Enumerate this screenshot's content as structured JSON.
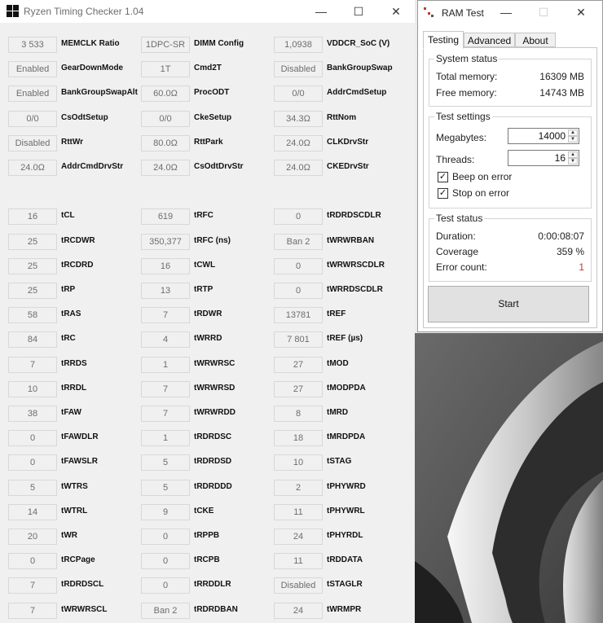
{
  "rtc": {
    "title": "Ryzen Timing Checker 1.04",
    "minimize_glyph": "—",
    "maximize_glyph": "☐",
    "close_glyph": "✕",
    "columns": [
      [
        {
          "value": "3 533",
          "label": "MEMCLK Ratio"
        },
        {
          "value": "Enabled",
          "label": "GearDownMode"
        },
        {
          "value": "Enabled",
          "label": "BankGroupSwapAlt"
        },
        {
          "value": "0/0",
          "label": "CsOdtSetup"
        },
        {
          "value": "Disabled",
          "label": "RttWr"
        },
        {
          "value": "24.0Ω",
          "label": "AddrCmdDrvStr"
        },
        null,
        {
          "value": "16",
          "label": "tCL"
        },
        {
          "value": "25",
          "label": "tRCDWR"
        },
        {
          "value": "25",
          "label": "tRCDRD"
        },
        {
          "value": "25",
          "label": "tRP"
        },
        {
          "value": "58",
          "label": "tRAS"
        },
        {
          "value": "84",
          "label": "tRC"
        },
        {
          "value": "7",
          "label": "tRRDS"
        },
        {
          "value": "10",
          "label": "tRRDL"
        },
        {
          "value": "38",
          "label": "tFAW"
        },
        {
          "value": "0",
          "label": "tFAWDLR"
        },
        {
          "value": "0",
          "label": "tFAWSLR"
        },
        {
          "value": "5",
          "label": "tWTRS"
        },
        {
          "value": "14",
          "label": "tWTRL"
        },
        {
          "value": "20",
          "label": "tWR"
        },
        {
          "value": "0",
          "label": "tRCPage"
        },
        {
          "value": "7",
          "label": "tRDRDSCL"
        },
        {
          "value": "7",
          "label": "tWRWRSCL"
        }
      ],
      [
        {
          "value": "1DPC-SR",
          "label": "DIMM Config"
        },
        {
          "value": "1T",
          "label": "Cmd2T"
        },
        {
          "value": "60.0Ω",
          "label": "ProcODT"
        },
        {
          "value": "0/0",
          "label": "CkeSetup"
        },
        {
          "value": "80.0Ω",
          "label": "RttPark"
        },
        {
          "value": "24.0Ω",
          "label": "CsOdtDrvStr"
        },
        null,
        {
          "value": "619",
          "label": "tRFC"
        },
        {
          "value": "350,377",
          "label": "tRFC (ns)"
        },
        {
          "value": "16",
          "label": "tCWL"
        },
        {
          "value": "13",
          "label": "tRTP"
        },
        {
          "value": "7",
          "label": "tRDWR"
        },
        {
          "value": "4",
          "label": "tWRRD"
        },
        {
          "value": "1",
          "label": "tWRWRSC"
        },
        {
          "value": "7",
          "label": "tWRWRSD"
        },
        {
          "value": "7",
          "label": "tWRWRDD"
        },
        {
          "value": "1",
          "label": "tRDRDSC"
        },
        {
          "value": "5",
          "label": "tRDRDSD"
        },
        {
          "value": "5",
          "label": "tRDRDDD"
        },
        {
          "value": "9",
          "label": "tCKE"
        },
        {
          "value": "0",
          "label": "tRPPB"
        },
        {
          "value": "0",
          "label": "tRCPB"
        },
        {
          "value": "0",
          "label": "tRRDDLR"
        },
        {
          "value": "Ban 2",
          "label": "tRDRDBAN"
        }
      ],
      [
        {
          "value": "1,0938",
          "label": "VDDCR_SoC (V)"
        },
        {
          "value": "Disabled",
          "label": "BankGroupSwap"
        },
        {
          "value": "0/0",
          "label": "AddrCmdSetup"
        },
        {
          "value": "34.3Ω",
          "label": "RttNom"
        },
        {
          "value": "24.0Ω",
          "label": "CLKDrvStr"
        },
        {
          "value": "24.0Ω",
          "label": "CKEDrvStr"
        },
        null,
        {
          "value": "0",
          "label": "tRDRDSCDLR"
        },
        {
          "value": "Ban 2",
          "label": "tWRWRBAN"
        },
        {
          "value": "0",
          "label": "tWRWRSCDLR"
        },
        {
          "value": "0",
          "label": "tWRRDSCDLR"
        },
        {
          "value": "13781",
          "label": "tREF"
        },
        {
          "value": "7 801",
          "label": "tREF (µs)"
        },
        {
          "value": "27",
          "label": "tMOD"
        },
        {
          "value": "27",
          "label": "tMODPDA"
        },
        {
          "value": "8",
          "label": "tMRD"
        },
        {
          "value": "18",
          "label": "tMRDPDA"
        },
        {
          "value": "10",
          "label": "tSTAG"
        },
        {
          "value": "2",
          "label": "tPHYWRD"
        },
        {
          "value": "11",
          "label": "tPHYWRL"
        },
        {
          "value": "24",
          "label": "tPHYRDL"
        },
        {
          "value": "11",
          "label": "tRDDATA"
        },
        {
          "value": "Disabled",
          "label": "tSTAGLR"
        },
        {
          "value": "24",
          "label": "tWRMPR"
        }
      ]
    ]
  },
  "ramtest": {
    "title": "RAM Test",
    "minimize_glyph": "—",
    "maximize_glyph": "☐",
    "close_glyph": "✕",
    "tabs": [
      "Testing",
      "Advanced",
      "About"
    ],
    "system_status": {
      "title": "System status",
      "total_label": "Total memory:",
      "total_value": "16309 MB",
      "free_label": "Free memory:",
      "free_value": "14743 MB"
    },
    "test_settings": {
      "title": "Test settings",
      "megabytes_label": "Megabytes:",
      "megabytes_value": "14000",
      "threads_label": "Threads:",
      "threads_value": "16",
      "beep_label": "Beep on error",
      "stop_label": "Stop on error",
      "check_glyph": "✓",
      "up_glyph": "▲",
      "down_glyph": "▼"
    },
    "test_status": {
      "title": "Test status",
      "duration_label": "Duration:",
      "duration_value": "0:00:08:07",
      "coverage_label": "Coverage",
      "coverage_value": "359 %",
      "errors_label": "Error count:",
      "errors_value": "1",
      "error_color": "#c0392b"
    },
    "start_label": "Start"
  }
}
